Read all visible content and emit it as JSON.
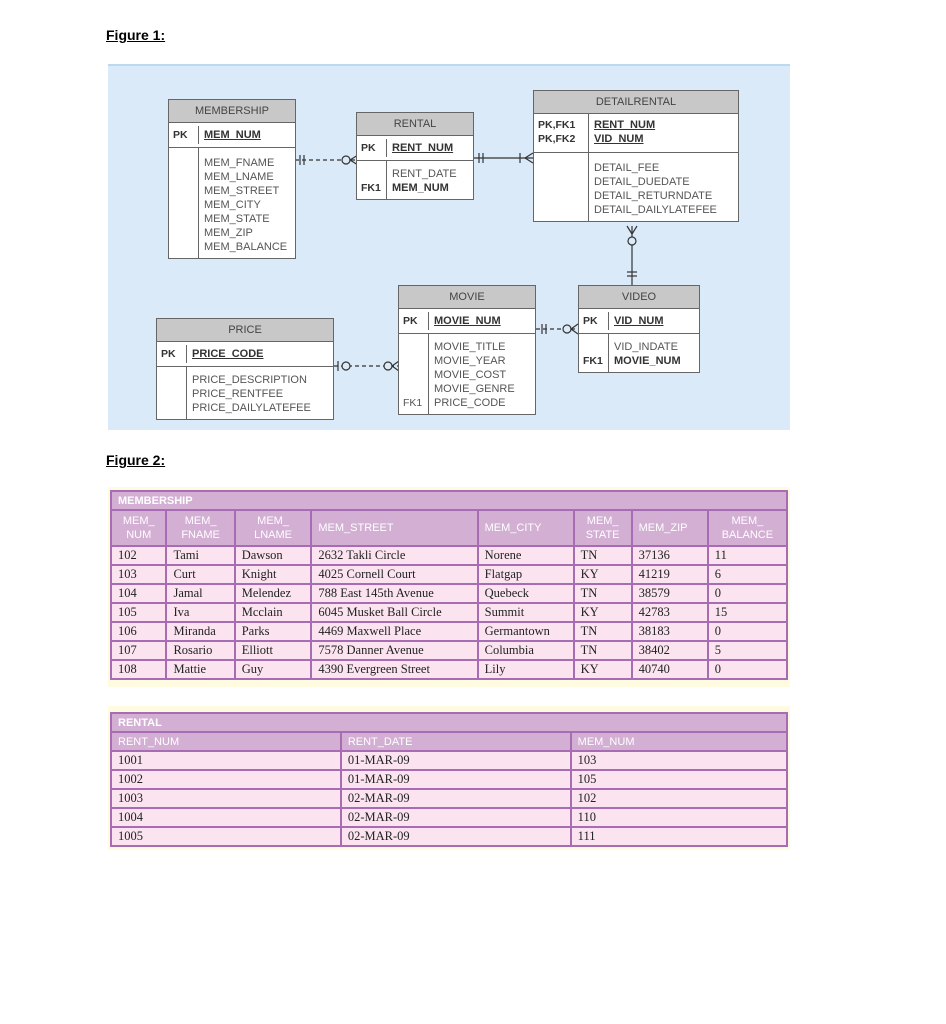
{
  "figure1": {
    "label": "Figure 1:",
    "entities": {
      "membership": {
        "name": "MEMBERSHIP",
        "pk_label": "PK",
        "pk": "MEM_NUM",
        "attrs": [
          "MEM_FNAME",
          "MEM_LNAME",
          "MEM_STREET",
          "MEM_CITY",
          "MEM_STATE",
          "MEM_ZIP",
          "MEM_BALANCE"
        ]
      },
      "rental": {
        "name": "RENTAL",
        "pk_label": "PK",
        "pk": "RENT_NUM",
        "attrs": [
          "RENT_DATE"
        ],
        "fk_label": "FK1",
        "fk": "MEM_NUM"
      },
      "detailrental": {
        "name": "DETAILRENTAL",
        "pk_labels": [
          "PK,FK1",
          "PK,FK2"
        ],
        "pks": [
          "RENT_NUM",
          "VID_NUM"
        ],
        "attrs": [
          "DETAIL_FEE",
          "DETAIL_DUEDATE",
          "DETAIL_RETURNDATE",
          "DETAIL_DAILYLATEFEE"
        ]
      },
      "price": {
        "name": "PRICE",
        "pk_label": "PK",
        "pk": "PRICE_CODE",
        "attrs": [
          "PRICE_DESCRIPTION",
          "PRICE_RENTFEE",
          "PRICE_DAILYLATEFEE"
        ]
      },
      "movie": {
        "name": "MOVIE",
        "pk_label": "PK",
        "pk": "MOVIE_NUM",
        "attrs": [
          "MOVIE_TITLE",
          "MOVIE_YEAR",
          "MOVIE_COST",
          "MOVIE_GENRE"
        ],
        "fk_label": "FK1",
        "fk": "PRICE_CODE"
      },
      "video": {
        "name": "VIDEO",
        "pk_label": "PK",
        "pk": "VID_NUM",
        "attrs": [
          "VID_INDATE"
        ],
        "fk_label": "FK1",
        "fk": "MOVIE_NUM"
      }
    }
  },
  "figure2": {
    "label": "Figure 2:",
    "membership": {
      "title": "MEMBERSHIP",
      "headers": [
        [
          "MEM_",
          "NUM"
        ],
        [
          "MEM_",
          "FNAME"
        ],
        [
          "MEM_",
          "LNAME"
        ],
        [
          "MEM_STREET"
        ],
        [
          "MEM_CITY"
        ],
        [
          "MEM_",
          "STATE"
        ],
        [
          "MEM_ZIP"
        ],
        [
          "MEM_",
          "BALANCE"
        ]
      ],
      "rows": [
        [
          "102",
          "Tami",
          "Dawson",
          "2632 Takli Circle",
          "Norene",
          "TN",
          "37136",
          "11"
        ],
        [
          "103",
          "Curt",
          "Knight",
          "4025 Cornell Court",
          "Flatgap",
          "KY",
          "41219",
          "6"
        ],
        [
          "104",
          "Jamal",
          "Melendez",
          "788 East 145th Avenue",
          "Quebeck",
          "TN",
          "38579",
          "0"
        ],
        [
          "105",
          "Iva",
          "Mcclain",
          "6045 Musket Ball Circle",
          "Summit",
          "KY",
          "42783",
          "15"
        ],
        [
          "106",
          "Miranda",
          "Parks",
          "4469 Maxwell Place",
          "Germantown",
          "TN",
          "38183",
          "0"
        ],
        [
          "107",
          "Rosario",
          "Elliott",
          "7578 Danner Avenue",
          "Columbia",
          "TN",
          "38402",
          "5"
        ],
        [
          "108",
          "Mattie",
          "Guy",
          "4390 Evergreen Street",
          "Lily",
          "KY",
          "40740",
          "0"
        ]
      ]
    },
    "rental": {
      "title": "RENTAL",
      "headers": [
        "RENT_NUM",
        "RENT_DATE",
        "MEM_NUM"
      ],
      "rows": [
        [
          "1001",
          "01-MAR-09",
          "103"
        ],
        [
          "1002",
          "01-MAR-09",
          "105"
        ],
        [
          "1003",
          "02-MAR-09",
          "102"
        ],
        [
          "1004",
          "02-MAR-09",
          "110"
        ],
        [
          "1005",
          "02-MAR-09",
          "111"
        ]
      ]
    }
  }
}
